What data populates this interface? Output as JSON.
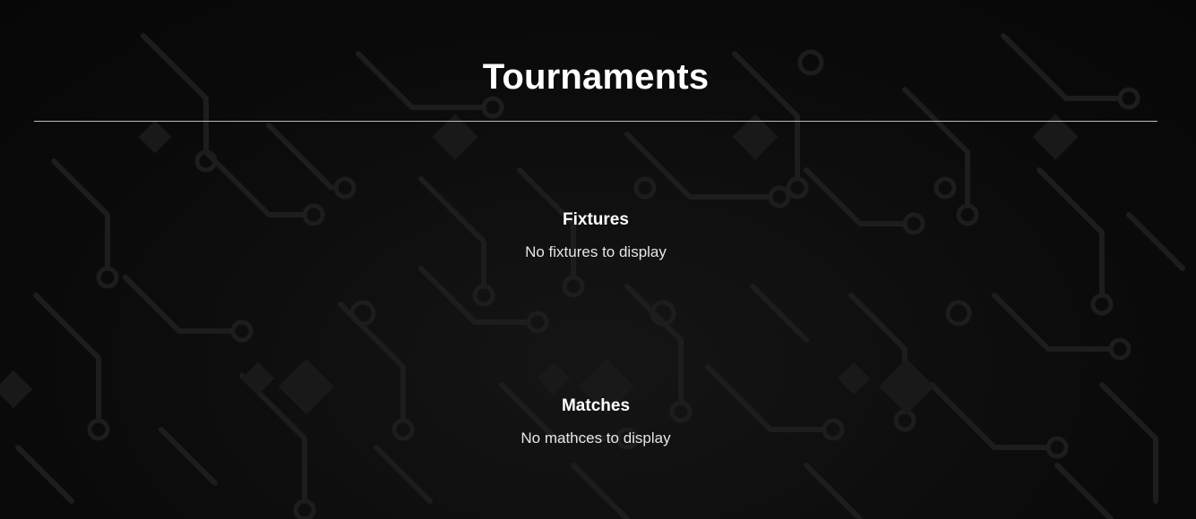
{
  "page": {
    "title": "Tournaments"
  },
  "fixtures": {
    "heading": "Fixtures",
    "empty_message": "No fixtures to display"
  },
  "matches": {
    "heading": "Matches",
    "empty_message": "No mathces to display"
  },
  "colors": {
    "background": "#0a0a0a",
    "pattern": "#1c1c1c",
    "text": "#ffffff",
    "divider": "#bdbdbd"
  }
}
